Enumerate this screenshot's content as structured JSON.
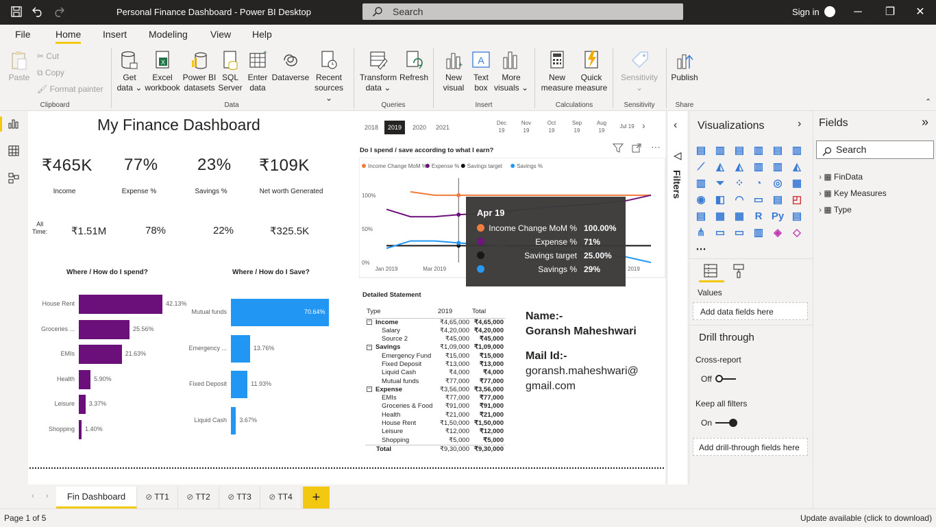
{
  "window": {
    "title": "Personal Finance Dashboard - Power BI Desktop",
    "search_placeholder": "Search",
    "sign_in": "Sign in"
  },
  "menu": [
    "File",
    "Home",
    "Insert",
    "Modeling",
    "View",
    "Help"
  ],
  "ribbon": {
    "clipboard": {
      "paste": "Paste",
      "cut": "Cut",
      "copy": "Copy",
      "format_painter": "Format painter",
      "group": "Clipboard"
    },
    "data": {
      "get_data": [
        "Get",
        "data ⌄"
      ],
      "excel": [
        "Excel",
        "workbook"
      ],
      "pbi": [
        "Power BI",
        "datasets"
      ],
      "sql": [
        "SQL",
        "Server"
      ],
      "enter": [
        "Enter",
        "data"
      ],
      "dataverse": "Dataverse",
      "recent": [
        "Recent",
        "sources ⌄"
      ],
      "group": "Data"
    },
    "queries": {
      "transform": [
        "Transform",
        "data ⌄"
      ],
      "refresh": "Refresh",
      "group": "Queries"
    },
    "insert": {
      "new_visual": [
        "New",
        "visual"
      ],
      "text_box": [
        "Text",
        "box"
      ],
      "more_visuals": [
        "More",
        "visuals ⌄"
      ],
      "group": "Insert"
    },
    "calc": {
      "new_measure": [
        "New",
        "measure"
      ],
      "quick_measure": [
        "Quick",
        "measure"
      ],
      "group": "Calculations"
    },
    "sensitivity": {
      "label": "Sensitivity",
      "group": "Sensitivity"
    },
    "share": {
      "publish": "Publish",
      "group": "Share"
    }
  },
  "dashboard": {
    "title": "My Finance Dashboard",
    "kpis": [
      {
        "value": "₹465K",
        "label": "Income"
      },
      {
        "value": "77%",
        "label": "Expense %"
      },
      {
        "value": "23%",
        "label": "Savings %"
      },
      {
        "value": "₹109K",
        "label": "Net worth Generated"
      }
    ],
    "all_time_label": [
      "All",
      "Time:"
    ],
    "all_time": [
      "₹1.51M",
      "78%",
      "22%",
      "₹325.5K"
    ],
    "years": [
      "2018",
      "2019",
      "2020",
      "2021"
    ],
    "selected_year": "2019",
    "months": [
      [
        "Dec",
        "19"
      ],
      [
        "Nov",
        "19"
      ],
      [
        "Oct",
        "19"
      ],
      [
        "Sep",
        "19"
      ],
      [
        "Aug",
        "19"
      ],
      [
        "Jul 19",
        ""
      ]
    ],
    "name_label": "Name:-",
    "name": "Goransh Maheshwari",
    "mail_label": "Mail Id:-",
    "mail_1": "goransh.maheshwari@",
    "mail_2": "gmail.com"
  },
  "chart_data": [
    {
      "type": "bar",
      "orientation": "horizontal",
      "title": "Where / How do I spend?",
      "categories": [
        "House Rent",
        "Groceries ...",
        "EMIs",
        "Health",
        "Leisure",
        "Shopping"
      ],
      "values": [
        42.13,
        25.56,
        21.63,
        5.9,
        3.37,
        1.4
      ],
      "value_labels": [
        "42.13%",
        "25.56%",
        "21.63%",
        "5.90%",
        "3.37%",
        "1.40%"
      ],
      "color": "#6b0f7a"
    },
    {
      "type": "bar",
      "orientation": "horizontal",
      "title": "Where / How do I Save?",
      "categories": [
        "Mutual funds",
        "Emergency ...",
        "Fixed Deposit",
        "Liquid Cash"
      ],
      "values": [
        70.64,
        13.76,
        11.93,
        3.67
      ],
      "value_labels": [
        "70.64%",
        "13.76%",
        "11.93%",
        "3.67%"
      ],
      "color": "#2196f3"
    },
    {
      "type": "line",
      "title": "Do I spend / save according to what I earn?",
      "x": [
        "Jan 2019",
        "Feb 2019",
        "Mar 2019",
        "Apr 2019",
        "May 2019",
        "Jun 2019",
        "Jul 2019",
        "Aug 2019",
        "Sep 2019",
        "Oct 2019",
        "Nov 2019",
        "Dec 2019"
      ],
      "x_tick_labels": [
        "Jan 2019",
        "Mar 2019",
        "2019"
      ],
      "y_tick_labels": [
        "100%",
        "50%",
        "0%"
      ],
      "ylim": [
        0,
        110
      ],
      "legend_position": "top-left",
      "series": [
        {
          "name": "Income Change MoM %",
          "color": "#f07a3a",
          "values": [
            null,
            105,
            100,
            100,
            100,
            100,
            100,
            100,
            100,
            100,
            100,
            100
          ]
        },
        {
          "name": "Expense %",
          "color": "#6b0f7a",
          "values": [
            79,
            68,
            68,
            71,
            73,
            76,
            80,
            83,
            85,
            88,
            92,
            100
          ]
        },
        {
          "name": "Savings target",
          "color": "#111111",
          "values": [
            25,
            25,
            25,
            25,
            25,
            25,
            25,
            25,
            25,
            25,
            25,
            25
          ]
        },
        {
          "name": "Savings %",
          "color": "#2196f3",
          "values": [
            21,
            32,
            32,
            29,
            27,
            24,
            20,
            17,
            15,
            12,
            8,
            0
          ]
        }
      ],
      "tooltip": {
        "title": "Apr 19",
        "rows": [
          {
            "label": "Income Change MoM %",
            "value": "100.00%",
            "color": "#f07a3a"
          },
          {
            "label": "Expense %",
            "value": "71%",
            "color": "#6b0f7a"
          },
          {
            "label": "Savings target",
            "value": "25.00%",
            "color": "#111111"
          },
          {
            "label": "Savings %",
            "value": "29%",
            "color": "#2196f3"
          }
        ]
      }
    },
    {
      "type": "table",
      "title": "Detailed Statement",
      "columns": [
        "Type",
        "2019",
        "Total"
      ],
      "rows": [
        {
          "label": "Income",
          "level": 0,
          "v2019": "₹4,65,000",
          "total": "₹4,65,000"
        },
        {
          "label": "Salary",
          "level": 1,
          "v2019": "₹4,20,000",
          "total": "₹4,20,000"
        },
        {
          "label": "Source 2",
          "level": 1,
          "v2019": "₹45,000",
          "total": "₹45,000"
        },
        {
          "label": "Savings",
          "level": 0,
          "v2019": "₹1,09,000",
          "total": "₹1,09,000"
        },
        {
          "label": "Emergency Fund",
          "level": 1,
          "v2019": "₹15,000",
          "total": "₹15,000"
        },
        {
          "label": "Fixed Deposit",
          "level": 1,
          "v2019": "₹13,000",
          "total": "₹13,000"
        },
        {
          "label": "Liquid Cash",
          "level": 1,
          "v2019": "₹4,000",
          "total": "₹4,000"
        },
        {
          "label": "Mutual funds",
          "level": 1,
          "v2019": "₹77,000",
          "total": "₹77,000"
        },
        {
          "label": "Expense",
          "level": 0,
          "v2019": "₹3,56,000",
          "total": "₹3,56,000"
        },
        {
          "label": "EMIs",
          "level": 1,
          "v2019": "₹77,000",
          "total": "₹77,000"
        },
        {
          "label": "Groceries & Food",
          "level": 1,
          "v2019": "₹91,000",
          "total": "₹91,000"
        },
        {
          "label": "Health",
          "level": 1,
          "v2019": "₹21,000",
          "total": "₹21,000"
        },
        {
          "label": "House Rent",
          "level": 1,
          "v2019": "₹1,50,000",
          "total": "₹1,50,000"
        },
        {
          "label": "Leisure",
          "level": 1,
          "v2019": "₹12,000",
          "total": "₹12,000"
        },
        {
          "label": "Shopping",
          "level": 1,
          "v2019": "₹5,000",
          "total": "₹5,000"
        },
        {
          "label": "Total",
          "level": -1,
          "v2019": "₹9,30,000",
          "total": "₹9,30,000"
        }
      ]
    }
  ],
  "panes": {
    "filters": "Filters",
    "visualizations": "Visualizations",
    "values": "Values",
    "add_data_fields": "Add data fields here",
    "drill_through": "Drill through",
    "cross_report": "Cross-report",
    "cross_report_state": "Off",
    "keep_filters": "Keep all filters",
    "keep_filters_state": "On",
    "add_drill": "Add drill-through fields here",
    "fields": "Fields",
    "fields_search": "Search",
    "tables": [
      "FinData",
      "Key Measures",
      "Type"
    ]
  },
  "tabs": [
    "Fin Dashboard",
    "TT1",
    "TT2",
    "TT3",
    "TT4"
  ],
  "active_tab": "Fin Dashboard",
  "status": {
    "page": "Page 1 of 5",
    "update": "Update available (click to download)"
  },
  "colors": {
    "accent": "#f2c811",
    "spend_bar": "#6b0f7a",
    "save_bar": "#2196f3",
    "titlebar": "#252423"
  }
}
